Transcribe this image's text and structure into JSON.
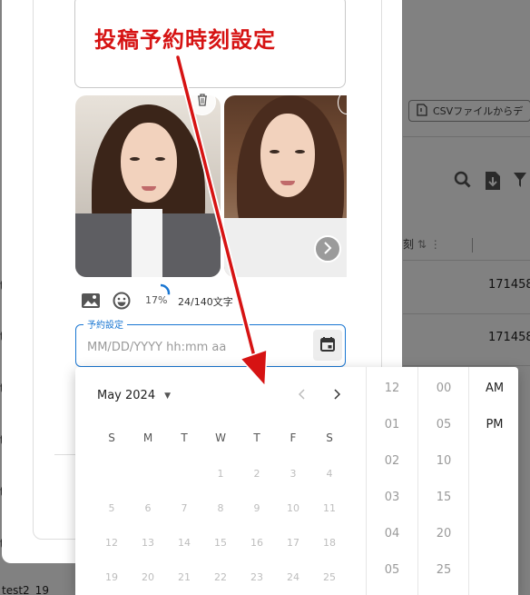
{
  "annotation": {
    "text": "投稿予約時刻設定"
  },
  "background": {
    "csv_button_label": "CSVファイルからデ",
    "toolbar_icons": [
      "search-icon",
      "download-icon",
      "filter-icon"
    ],
    "header_fragment": "刻",
    "cell_values": [
      "171458",
      "171458"
    ],
    "edge_values": [
      "t",
      "t",
      "t",
      "t",
      "t",
      "t",
      "t"
    ],
    "bottom_row_text": "test2_19"
  },
  "dialog": {
    "images": [
      {
        "icon": "trash-icon"
      },
      {
        "icon": "chevron-right-icon"
      }
    ],
    "tools": {
      "icons": [
        "image-icon",
        "emoji-icon"
      ],
      "progress_percent": 17,
      "percent_label": "17%",
      "char_count": "24/140文字"
    },
    "schedule_field": {
      "label": "予約設定",
      "placeholder": "MM/DD/YYYY hh:mm aa",
      "button_icon": "calendar-icon"
    }
  },
  "picker": {
    "month_label": "May 2024",
    "weekdays": [
      "S",
      "M",
      "T",
      "W",
      "T",
      "F",
      "S"
    ],
    "weeks": [
      [
        "",
        "",
        "",
        "1",
        "2",
        "3",
        "4"
      ],
      [
        "5",
        "6",
        "7",
        "8",
        "9",
        "10",
        "11"
      ],
      [
        "12",
        "13",
        "14",
        "15",
        "16",
        "17",
        "18"
      ],
      [
        "19",
        "20",
        "21",
        "22",
        "23",
        "24",
        "25"
      ]
    ],
    "hours": [
      "12",
      "01",
      "02",
      "03",
      "04",
      "05"
    ],
    "minutes": [
      "00",
      "05",
      "10",
      "15",
      "20",
      "25"
    ],
    "meridiem": [
      "AM",
      "PM"
    ]
  },
  "colors": {
    "accent": "#1976d2",
    "annotation": "#d61313"
  }
}
